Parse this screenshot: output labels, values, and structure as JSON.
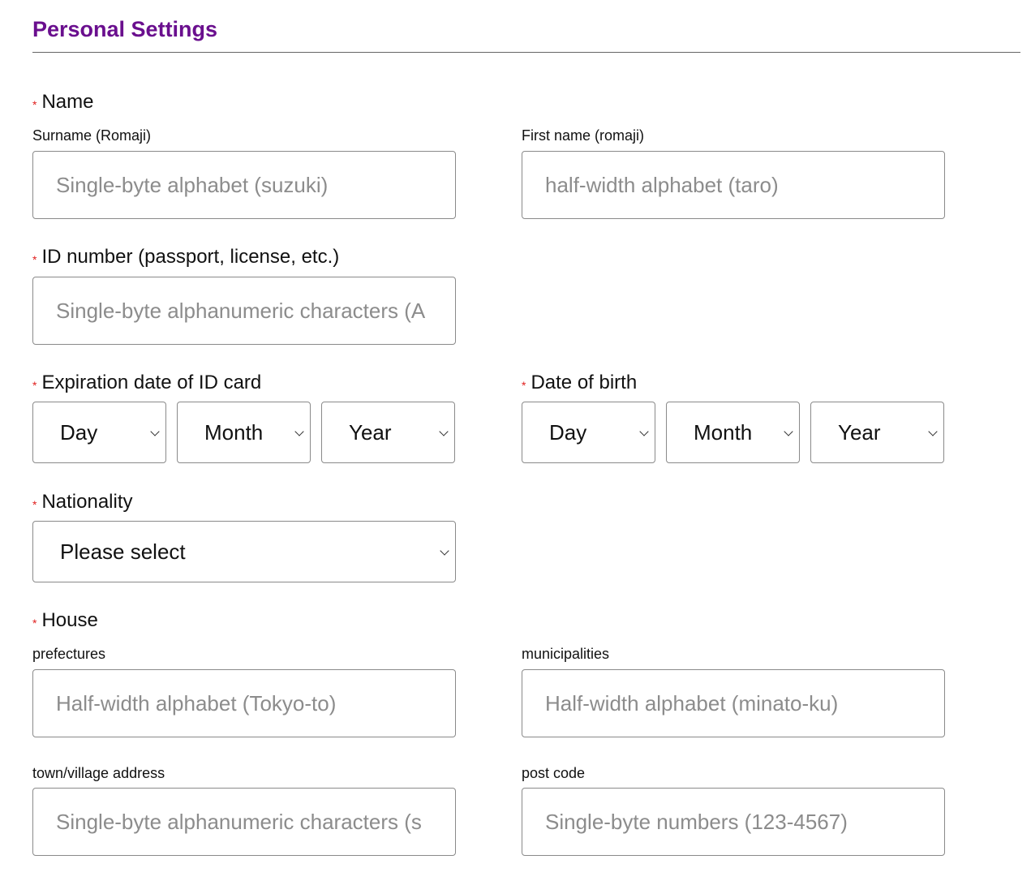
{
  "page": {
    "title": "Personal Settings"
  },
  "name_section": {
    "label": "Name",
    "surname_label": "Surname (Romaji)",
    "surname_placeholder": "Single-byte alphabet (suzuki)",
    "first_name_label": "First name (romaji)",
    "first_name_placeholder": "half-width alphabet (taro)"
  },
  "id_section": {
    "label": "ID number (passport, license, etc.)",
    "placeholder": "Single-byte alphanumeric characters (A"
  },
  "expiration_section": {
    "label": "Expiration date of ID card",
    "day": "Day",
    "month": "Month",
    "year": "Year"
  },
  "birth_section": {
    "label": "Date of birth",
    "day": "Day",
    "month": "Month",
    "year": "Year"
  },
  "nationality_section": {
    "label": "Nationality",
    "selected": "Please select"
  },
  "house_section": {
    "label": "House",
    "prefectures_label": "prefectures",
    "prefectures_placeholder": "Half-width alphabet (Tokyo-to)",
    "municipalities_label": "municipalities",
    "municipalities_placeholder": "Half-width alphabet (minato-ku)",
    "town_label": "town/village address",
    "town_placeholder": "Single-byte alphanumeric characters (s",
    "postcode_label": "post code",
    "postcode_placeholder": "Single-byte numbers (123-4567)"
  },
  "required_marker": "*",
  "colors": {
    "title": "#6a0f8e",
    "required": "#e0201f",
    "border": "#8a8a8a",
    "placeholder": "#8c8c8c"
  }
}
